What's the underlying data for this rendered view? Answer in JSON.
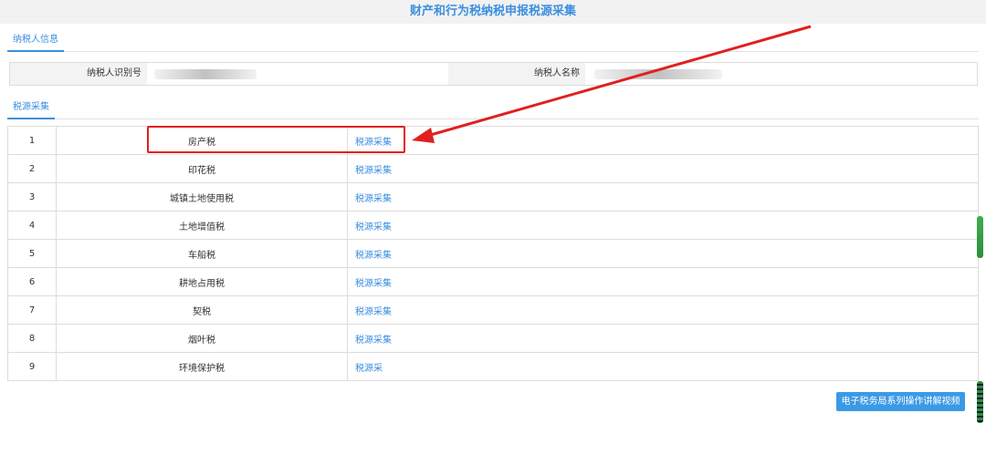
{
  "page_title": "财产和行为税纳税申报税源采集",
  "taxpayer_tab": "纳税人信息",
  "taxpayer_info": {
    "id_label": "纳税人识别号",
    "name_label": "纳税人名称"
  },
  "source_tab": "税源采集",
  "rows": [
    {
      "num": "1",
      "name": "房产税",
      "action": "税源采集"
    },
    {
      "num": "2",
      "name": "印花税",
      "action": "税源采集"
    },
    {
      "num": "3",
      "name": "城镇土地使用税",
      "action": "税源采集"
    },
    {
      "num": "4",
      "name": "土地增值税",
      "action": "税源采集"
    },
    {
      "num": "5",
      "name": "车船税",
      "action": "税源采集"
    },
    {
      "num": "6",
      "name": "耕地占用税",
      "action": "税源采集"
    },
    {
      "num": "7",
      "name": "契税",
      "action": "税源采集"
    },
    {
      "num": "8",
      "name": "烟叶税",
      "action": "税源采集"
    },
    {
      "num": "9",
      "name": "环境保护税",
      "action": "税源采"
    }
  ],
  "video_button": "电子税务局系列操作讲解视频",
  "colors": {
    "accent": "#3b8fde",
    "highlight": "#e02020"
  }
}
